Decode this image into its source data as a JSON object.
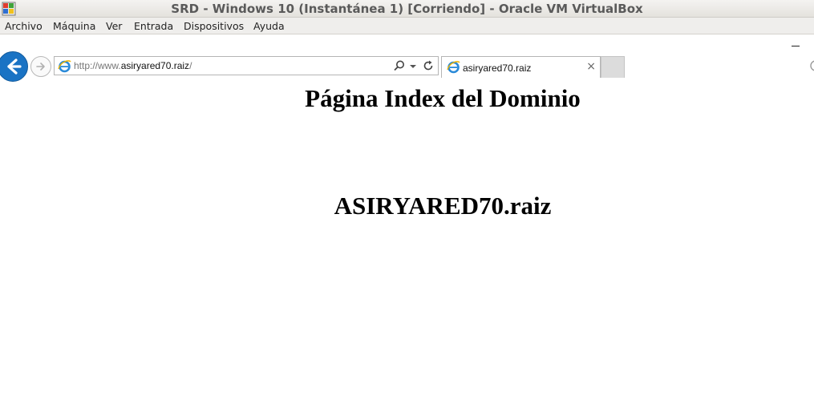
{
  "window": {
    "title": "SRD - Windows 10 (Instantánea 1) [Corriendo] - Oracle VM VirtualBox"
  },
  "menubar": {
    "items": [
      "Archivo",
      "Máquina",
      "Ver",
      "Entrada",
      "Dispositivos",
      "Ayuda"
    ]
  },
  "browser": {
    "address": {
      "prefix": "http://www.",
      "domain": "asiryared70.raiz",
      "suffix": "/"
    },
    "tab": {
      "title": "asiryared70.raiz",
      "close_glyph": "×"
    }
  },
  "page": {
    "heading": "Página Index del Dominio",
    "domain_text": "ASIRYARED70.raiz"
  },
  "colors": {
    "back_button": "#1a73c4",
    "ie_icon": "#2a8ad8",
    "ie_ring": "#f0b400"
  }
}
